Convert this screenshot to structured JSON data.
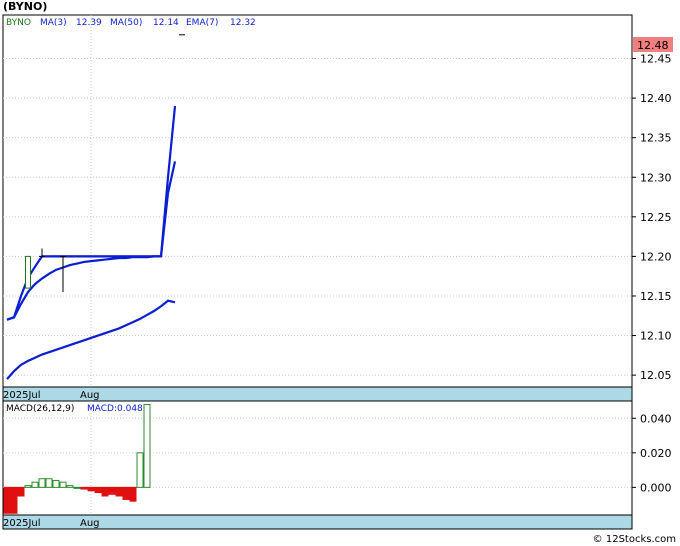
{
  "header": {
    "title": "(BYNO)"
  },
  "footer": {
    "text": "© 12Stocks.com"
  },
  "colors": {
    "ma_line": "#0a1ed2",
    "red_line": "#dd0000",
    "up_candle": "#1b7a1b",
    "hist_pos": "#2e8b2e",
    "hist_neg": "#e01010",
    "axis_strip": "#add8e6",
    "price_tag": "#f08080"
  },
  "price_panel": {
    "legend": [
      {
        "text": "BYNO",
        "color": "#1b7a1b"
      },
      {
        "text": "MA(3)",
        "color": "#0a1ed2"
      },
      {
        "text": "12.39",
        "color": "#0a1ed2"
      },
      {
        "text": "MA(50)",
        "color": "#0a1ed2"
      },
      {
        "text": "12.14",
        "color": "#0a1ed2"
      },
      {
        "text": "EMA(7)",
        "color": "#0a1ed2"
      },
      {
        "text": "12.32",
        "color": "#0a1ed2"
      }
    ],
    "last_price_label": "12.48",
    "y_ticks": [
      "12.45",
      "12.40",
      "12.35",
      "12.30",
      "12.25",
      "12.20",
      "12.15",
      "12.10",
      "12.05"
    ],
    "x_labels": [
      "2025Jul",
      "Aug"
    ]
  },
  "macd_panel": {
    "legend": [
      {
        "text": "MACD(26,12,9)",
        "color": "#000000"
      },
      {
        "text": "MACD:0.048",
        "color": "#0a1ed2"
      }
    ],
    "y_ticks": [
      "0.040",
      "0.020",
      "0.000"
    ],
    "x_labels": [
      "2025Jul",
      "Aug"
    ]
  },
  "chart_data": [
    {
      "type": "line",
      "title": "(BYNO)",
      "ylim": [
        12.035,
        12.505
      ],
      "x_count": 25,
      "candles": [
        {
          "x": 3,
          "open": 12.16,
          "close": 12.2,
          "high": 12.2,
          "low": 12.16
        },
        {
          "x": 5,
          "open": 12.2,
          "close": 12.2,
          "high": 12.21,
          "low": 12.2
        },
        {
          "x": 8,
          "open": 12.2,
          "close": 12.2,
          "high": 12.2,
          "low": 12.155
        },
        {
          "x": 25,
          "open": 12.48,
          "close": 12.48,
          "high": 12.48,
          "low": 12.48
        }
      ],
      "series": [
        {
          "name": "MA(3)",
          "x": [
            0,
            1,
            2,
            3,
            4,
            5,
            6,
            7,
            8,
            9,
            10,
            11,
            12,
            13,
            14,
            15,
            16,
            17,
            18,
            19,
            20,
            21,
            22,
            23,
            24
          ],
          "values": [
            12.12,
            12.123,
            12.15,
            12.173,
            12.187,
            12.2,
            12.2,
            12.2,
            12.2,
            12.2,
            12.2,
            12.2,
            12.2,
            12.2,
            12.2,
            12.2,
            12.2,
            12.2,
            12.2,
            12.2,
            12.2,
            12.2,
            12.2,
            12.3,
            12.39
          ]
        },
        {
          "name": "EMA(7)",
          "x": [
            0,
            1,
            2,
            3,
            4,
            5,
            6,
            7,
            8,
            9,
            10,
            11,
            12,
            13,
            14,
            15,
            16,
            17,
            18,
            19,
            20,
            21,
            22,
            23,
            24
          ],
          "values": [
            12.12,
            12.123,
            12.14,
            12.155,
            12.165,
            12.172,
            12.178,
            12.183,
            12.186,
            12.189,
            12.191,
            12.193,
            12.194,
            12.195,
            12.196,
            12.197,
            12.198,
            12.198,
            12.199,
            12.199,
            12.199,
            12.2,
            12.2,
            12.28,
            12.32
          ]
        },
        {
          "name": "MA(50)",
          "x": [
            0,
            1,
            2,
            3,
            4,
            5,
            6,
            7,
            8,
            9,
            10,
            11,
            12,
            13,
            14,
            15,
            16,
            17,
            18,
            19,
            20,
            21,
            22,
            23,
            24
          ],
          "values": [
            12.045,
            12.055,
            12.063,
            12.068,
            12.072,
            12.076,
            12.079,
            12.082,
            12.085,
            12.088,
            12.091,
            12.094,
            12.097,
            12.1,
            12.103,
            12.106,
            12.109,
            12.113,
            12.117,
            12.121,
            12.126,
            12.131,
            12.137,
            12.144,
            12.142
          ]
        }
      ],
      "flat_line": {
        "x_from": 6,
        "x_to": 22,
        "value": 12.2
      }
    },
    {
      "type": "bar",
      "title": "MACD(26,12,9)",
      "ylim": [
        -0.016,
        0.05
      ],
      "x": [
        0,
        1,
        2,
        3,
        4,
        5,
        6,
        7,
        8,
        9,
        10,
        11,
        12,
        13,
        14,
        15,
        16,
        17,
        18,
        19,
        20,
        21,
        22,
        23,
        24
      ],
      "values": [
        -0.015,
        -0.015,
        -0.005,
        0.001,
        0.003,
        0.005,
        0.005,
        0.004,
        0.003,
        0.001,
        0.0,
        -0.001,
        -0.002,
        -0.003,
        -0.005,
        -0.004,
        -0.005,
        -0.007,
        -0.008,
        0.02,
        0.048
      ]
    }
  ]
}
